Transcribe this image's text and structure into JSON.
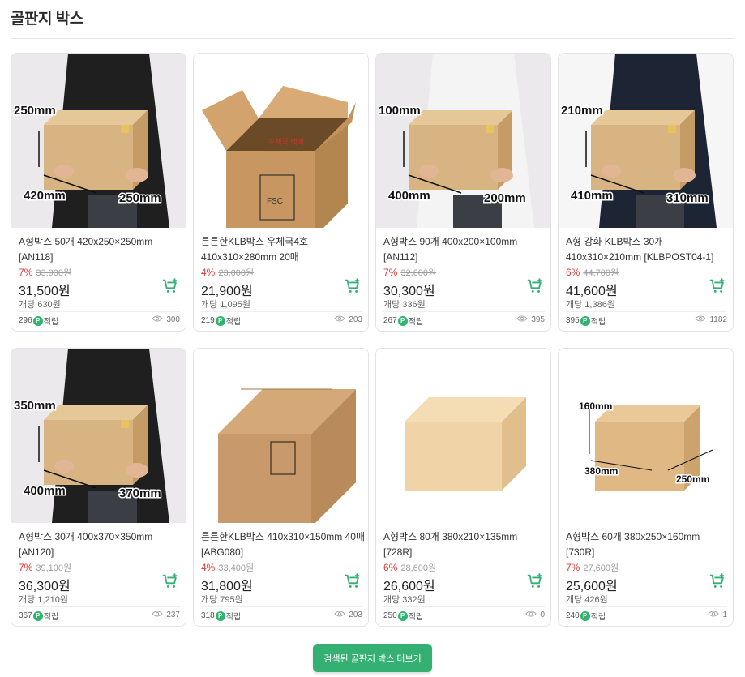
{
  "section": {
    "title": "골판지 박스"
  },
  "colors": {
    "accent": "#34b073",
    "discount": "#e53935",
    "points_badge": "#2fb36d"
  },
  "products": [
    {
      "name": "A형박스 50개 420x250×250mm [AN118]",
      "discount": "7%",
      "original_price": "33,900원",
      "price": "31,500원",
      "unit_price": "개당 630원",
      "points": "296",
      "points_label": "적립",
      "views": "300",
      "image": "person-holding-box",
      "dims": [
        "250mm",
        "420mm",
        "250mm"
      ]
    },
    {
      "name": "튼튼한KLB박스 우체국4호 410x310×280mm 20매",
      "discount": "4%",
      "original_price": "23,000원",
      "price": "21,900원",
      "unit_price": "개당 1,095원",
      "points": "219",
      "points_label": "적립",
      "views": "203",
      "image": "open-box-fsc",
      "dims": []
    },
    {
      "name": "A형박스 90개 400x200×100mm [AN112]",
      "discount": "7%",
      "original_price": "32,600원",
      "price": "30,300원",
      "unit_price": "개당 336원",
      "points": "267",
      "points_label": "적립",
      "views": "395",
      "image": "person-holding-box",
      "dims": [
        "100mm",
        "400mm",
        "200mm"
      ]
    },
    {
      "name": "A형 강화 KLB박스 30개 410x310×210mm [KLBPOST04-1]",
      "discount": "6%",
      "original_price": "44,700원",
      "price": "41,600원",
      "unit_price": "개당 1,386원",
      "points": "395",
      "points_label": "적립",
      "views": "1182",
      "image": "person-holding-box",
      "dims": [
        "210mm",
        "410mm",
        "310mm"
      ]
    },
    {
      "name": "A형박스 30개 400x370×350mm [AN120]",
      "discount": "7%",
      "original_price": "39,100원",
      "price": "36,300원",
      "unit_price": "개당 1,210원",
      "points": "367",
      "points_label": "적립",
      "views": "237",
      "image": "person-holding-box",
      "dims": [
        "350mm",
        "400mm",
        "370mm"
      ]
    },
    {
      "name": "튼튼한KLB박스 410x310×150mm 40매 [ABG080]",
      "discount": "4%",
      "original_price": "33,400원",
      "price": "31,800원",
      "unit_price": "개당 795원",
      "points": "318",
      "points_label": "적립",
      "views": "203",
      "image": "closed-box-fsc",
      "dims": []
    },
    {
      "name": "A형박스 80개 380x210×135mm [728R]",
      "discount": "6%",
      "original_price": "28,600원",
      "price": "26,600원",
      "unit_price": "개당 332원",
      "points": "250",
      "points_label": "적립",
      "views": "0",
      "image": "plain-box",
      "dims": []
    },
    {
      "name": "A형박스 60개 380x250×160mm [730R]",
      "discount": "7%",
      "original_price": "27,600원",
      "price": "25,600원",
      "unit_price": "개당 426원",
      "points": "240",
      "points_label": "적립",
      "views": "1",
      "image": "box-with-dims",
      "dims": [
        "160mm",
        "380mm",
        "250mm"
      ]
    }
  ],
  "more_button": {
    "label": "검색된 골판지 박스 더보기"
  }
}
